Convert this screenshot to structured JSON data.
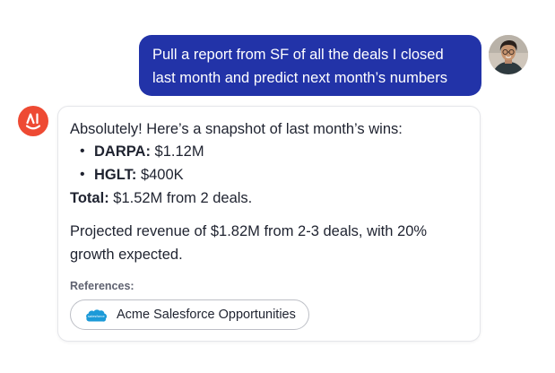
{
  "user_message": {
    "lines": [
      "Pull a report from SF of all the deals I closed",
      "last month and predict next month’s numbers"
    ]
  },
  "assistant_message": {
    "intro": "Absolutely! Here’s a snapshot of last month’s wins:",
    "bullets": [
      {
        "marker": "•",
        "label": "DARPA:",
        "value": " $1.12M"
      },
      {
        "marker": "•",
        "label": "HGLT:",
        "value": " $400K"
      }
    ],
    "total": {
      "label": "Total:",
      "value": " $1.52M from 2 deals."
    },
    "projection_lines": [
      "Projected revenue of $1.82M from 2-3 deals, with 20%",
      "growth expected."
    ],
    "references_label": "References:",
    "reference_chip": {
      "label": "Acme Salesforce Opportunities",
      "icon": "salesforce-cloud-icon",
      "icon_text": "salesforce"
    }
  },
  "avatars": {
    "user": "user-photo-avatar",
    "assistant": "assistant-logo-avatar"
  },
  "colors": {
    "user_bubble": "#2233a8",
    "assistant_logo": "#ee4a33",
    "salesforce_blue": "#1c9ad8"
  }
}
